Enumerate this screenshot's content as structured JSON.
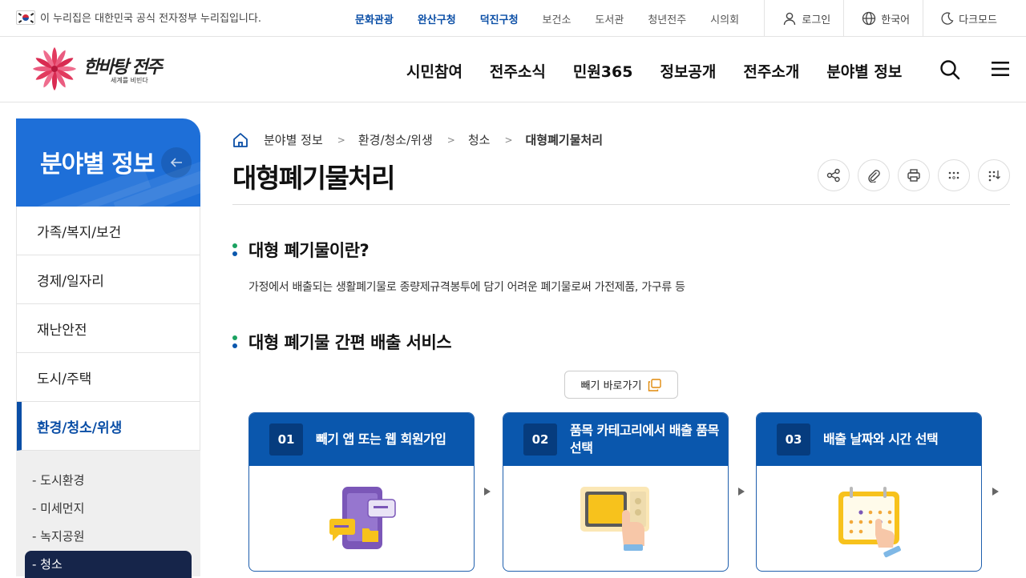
{
  "topbar": {
    "gov_notice": "이 누리집은 대한민국 공식 전자정부 누리집입니다.",
    "related_sites": [
      {
        "label": "문화관광",
        "highlight": true
      },
      {
        "label": "완산구청",
        "highlight": true
      },
      {
        "label": "덕진구청",
        "highlight": true
      },
      {
        "label": "보건소",
        "highlight": false
      },
      {
        "label": "도서관",
        "highlight": false
      },
      {
        "label": "청년전주",
        "highlight": false
      },
      {
        "label": "시의회",
        "highlight": false
      }
    ],
    "login_label": "로그인",
    "language_label": "한국어",
    "darkmode_label": "다크모드"
  },
  "header": {
    "logo_text": "한바탕 전주",
    "logo_slogan": "세계를 비빈다",
    "gnb": [
      "시민참여",
      "전주소식",
      "민원365",
      "정보공개",
      "전주소개",
      "분야별 정보"
    ],
    "icons": [
      "search-icon",
      "menu-icon"
    ]
  },
  "sidebar": {
    "title": "분야별 정보",
    "items": [
      {
        "label": "가족/복지/보건",
        "active": false
      },
      {
        "label": "경제/일자리",
        "active": false
      },
      {
        "label": "재난안전",
        "active": false
      },
      {
        "label": "도시/주택",
        "active": false
      },
      {
        "label": "환경/청소/위생",
        "active": true
      }
    ],
    "sub_items": [
      {
        "label": "- 도시환경",
        "active": false
      },
      {
        "label": "- 미세먼지",
        "active": false
      },
      {
        "label": "- 녹지공원",
        "active": false
      },
      {
        "label": "- 청소",
        "active": true
      }
    ]
  },
  "breadcrumb": [
    "분야별 정보",
    "환경/청소/위생",
    "청소",
    "대형폐기물처리"
  ],
  "page_title": "대형폐기물처리",
  "util_icons": [
    "share-icon",
    "attach-icon",
    "print-icon",
    "qr-icon",
    "braille-icon"
  ],
  "sections": {
    "s1_title": "대형 폐기물이란?",
    "s1_desc": "가정에서 배출되는 생활폐기물로 종량제규격봉투에 담기 어려운 폐기물로써 가전제품, 가구류 등",
    "s2_title": "대형 폐기물 간편 배출 서비스",
    "link_label": "빼기 바로가기"
  },
  "steps": [
    {
      "num": "01",
      "title": "빼기 앱 또는 웹 회원가입"
    },
    {
      "num": "02",
      "title": "품목 카테고리에서 배출 품목 선택"
    },
    {
      "num": "03",
      "title": "배출 날짜와 시간 선택"
    }
  ],
  "colors": {
    "primary": "#0a57ad",
    "sidebar_head": "#1e6fd8",
    "active_sub": "#16254a",
    "accent_green": "#1aa260"
  }
}
